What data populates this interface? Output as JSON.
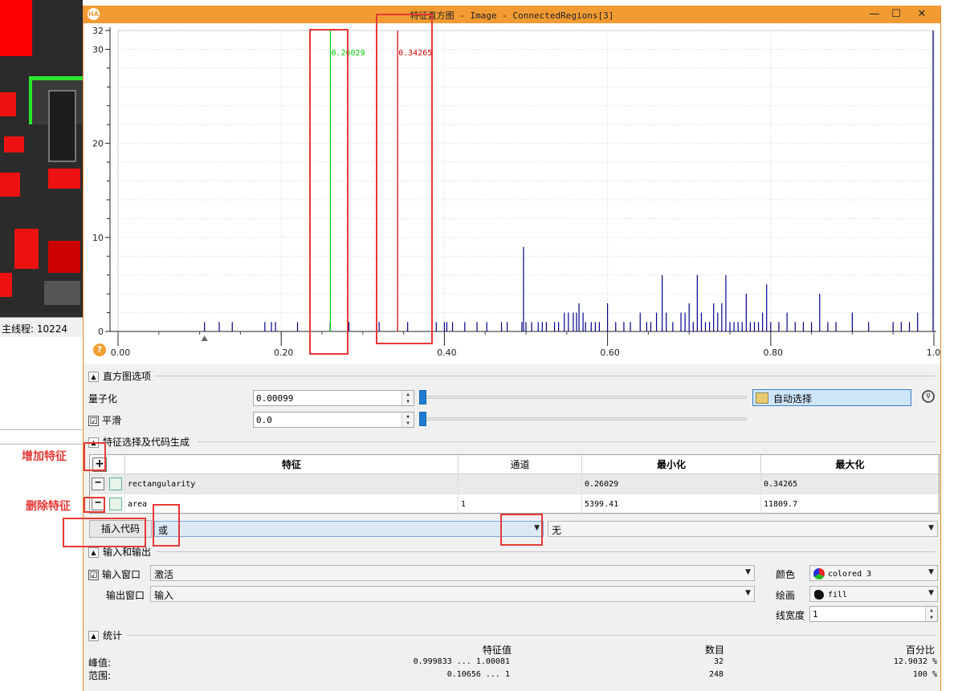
{
  "background": {
    "status_text": "主线程: 10224",
    "colors": {
      "overlay_red": "#ff0000",
      "overlay_green": "#2ee82e",
      "image_dark": "#2b2b2b"
    }
  },
  "annotations": {
    "add_feature": "增加特征",
    "delete_feature": "删除特征"
  },
  "window": {
    "title": "特征直方图 - Image - ConnectedRegions[3]",
    "app_icon": "HA",
    "controls": [
      "minimize-icon",
      "maximize-icon",
      "close-icon"
    ],
    "accent": "#f39b33"
  },
  "chart_data": {
    "type": "bar",
    "xlim": [
      0.0,
      1.0
    ],
    "ylim": [
      0,
      32
    ],
    "x_ticks": [
      "0.00",
      "0.20",
      "0.40",
      "0.60",
      "0.80",
      "1.00"
    ],
    "y_ticks": [
      "0",
      "10",
      "20",
      "30",
      "32"
    ],
    "grid": true,
    "series_color": "#00008b",
    "markers": [
      {
        "label": "0.26029",
        "x": 0.26029,
        "color": "#00cc00"
      },
      {
        "label": "0.34265",
        "x": 0.34265,
        "color": "#cc0000"
      }
    ],
    "bars": [
      {
        "x": 0.106,
        "y": 1
      },
      {
        "x": 0.124,
        "y": 1
      },
      {
        "x": 0.14,
        "y": 1
      },
      {
        "x": 0.18,
        "y": 1
      },
      {
        "x": 0.188,
        "y": 1
      },
      {
        "x": 0.193,
        "y": 1
      },
      {
        "x": 0.22,
        "y": 1
      },
      {
        "x": 0.235,
        "y": 1
      },
      {
        "x": 0.26,
        "y": 1
      },
      {
        "x": 0.283,
        "y": 1
      },
      {
        "x": 0.32,
        "y": 1
      },
      {
        "x": 0.355,
        "y": 1
      },
      {
        "x": 0.39,
        "y": 1
      },
      {
        "x": 0.4,
        "y": 1
      },
      {
        "x": 0.403,
        "y": 1
      },
      {
        "x": 0.41,
        "y": 1
      },
      {
        "x": 0.425,
        "y": 1
      },
      {
        "x": 0.44,
        "y": 1
      },
      {
        "x": 0.452,
        "y": 1
      },
      {
        "x": 0.47,
        "y": 1
      },
      {
        "x": 0.477,
        "y": 1
      },
      {
        "x": 0.495,
        "y": 1
      },
      {
        "x": 0.497,
        "y": 9
      },
      {
        "x": 0.5,
        "y": 1
      },
      {
        "x": 0.507,
        "y": 1
      },
      {
        "x": 0.515,
        "y": 1
      },
      {
        "x": 0.52,
        "y": 1
      },
      {
        "x": 0.525,
        "y": 1
      },
      {
        "x": 0.535,
        "y": 1
      },
      {
        "x": 0.54,
        "y": 1
      },
      {
        "x": 0.547,
        "y": 2
      },
      {
        "x": 0.552,
        "y": 2
      },
      {
        "x": 0.558,
        "y": 2
      },
      {
        "x": 0.562,
        "y": 2
      },
      {
        "x": 0.565,
        "y": 3
      },
      {
        "x": 0.57,
        "y": 2
      },
      {
        "x": 0.573,
        "y": 1
      },
      {
        "x": 0.58,
        "y": 1
      },
      {
        "x": 0.585,
        "y": 1
      },
      {
        "x": 0.59,
        "y": 1
      },
      {
        "x": 0.6,
        "y": 3
      },
      {
        "x": 0.61,
        "y": 1
      },
      {
        "x": 0.62,
        "y": 1
      },
      {
        "x": 0.628,
        "y": 1
      },
      {
        "x": 0.64,
        "y": 2
      },
      {
        "x": 0.648,
        "y": 1
      },
      {
        "x": 0.653,
        "y": 1
      },
      {
        "x": 0.66,
        "y": 2
      },
      {
        "x": 0.667,
        "y": 6
      },
      {
        "x": 0.672,
        "y": 2
      },
      {
        "x": 0.68,
        "y": 1
      },
      {
        "x": 0.69,
        "y": 2
      },
      {
        "x": 0.695,
        "y": 2
      },
      {
        "x": 0.7,
        "y": 3
      },
      {
        "x": 0.705,
        "y": 1
      },
      {
        "x": 0.71,
        "y": 6
      },
      {
        "x": 0.715,
        "y": 2
      },
      {
        "x": 0.72,
        "y": 1
      },
      {
        "x": 0.725,
        "y": 1
      },
      {
        "x": 0.73,
        "y": 3
      },
      {
        "x": 0.735,
        "y": 2
      },
      {
        "x": 0.74,
        "y": 3
      },
      {
        "x": 0.745,
        "y": 6
      },
      {
        "x": 0.75,
        "y": 1
      },
      {
        "x": 0.755,
        "y": 1
      },
      {
        "x": 0.76,
        "y": 1
      },
      {
        "x": 0.765,
        "y": 1
      },
      {
        "x": 0.77,
        "y": 4
      },
      {
        "x": 0.775,
        "y": 1
      },
      {
        "x": 0.78,
        "y": 1
      },
      {
        "x": 0.785,
        "y": 1
      },
      {
        "x": 0.79,
        "y": 2
      },
      {
        "x": 0.795,
        "y": 5
      },
      {
        "x": 0.8,
        "y": 1
      },
      {
        "x": 0.81,
        "y": 1
      },
      {
        "x": 0.82,
        "y": 2
      },
      {
        "x": 0.83,
        "y": 1
      },
      {
        "x": 0.84,
        "y": 1
      },
      {
        "x": 0.85,
        "y": 1
      },
      {
        "x": 0.86,
        "y": 4
      },
      {
        "x": 0.87,
        "y": 1
      },
      {
        "x": 0.88,
        "y": 1
      },
      {
        "x": 0.9,
        "y": 2
      },
      {
        "x": 0.92,
        "y": 1
      },
      {
        "x": 0.95,
        "y": 1
      },
      {
        "x": 0.96,
        "y": 1
      },
      {
        "x": 0.97,
        "y": 1
      },
      {
        "x": 0.98,
        "y": 2
      },
      {
        "x": 0.999,
        "y": 32
      }
    ]
  },
  "histogram_options": {
    "section_label": "直方图选项",
    "quantize_label": "量子化",
    "quantize_value": "0.00099",
    "smooth_label": "平滑",
    "smooth_checked": "☑",
    "smooth_value": "0.0",
    "auto_select_label": "自动选择"
  },
  "feature_section": {
    "section_label": "特征选择及代码生成",
    "add_symbol": "+",
    "columns": [
      "特征",
      "通道",
      "最小化",
      "最大化"
    ],
    "rows": [
      {
        "feature": "rectangularity",
        "channel": "",
        "min": "0.26029",
        "max": "0.34265"
      },
      {
        "feature": "area",
        "channel": "1",
        "min": "5399.41",
        "max": "11809.7"
      }
    ],
    "insert_code_label": "插入代码",
    "combine_value": "或",
    "combine2_value": "无"
  },
  "io_section": {
    "section_label": "输入和输出",
    "input_window_label": "输入窗口",
    "input_window_checked": "☑",
    "input_window_value": "激活",
    "output_window_label": "输出窗口",
    "output_window_value": "输入",
    "color_label": "颜色",
    "color_value": "colored 3",
    "draw_label": "绘画",
    "draw_value": "fill",
    "linewidth_label": "线宽度",
    "linewidth_value": "1"
  },
  "stats_section": {
    "section_label": "统计",
    "headers": [
      "特征值",
      "数目",
      "百分比"
    ],
    "rows": [
      {
        "label": "峰值:",
        "value": "0.999833 ... 1.00081",
        "count": "32",
        "percent": "12.9032 %"
      },
      {
        "label": "范围:",
        "value": "0.10656 ... 1",
        "count": "248",
        "percent": "100 %"
      }
    ]
  }
}
